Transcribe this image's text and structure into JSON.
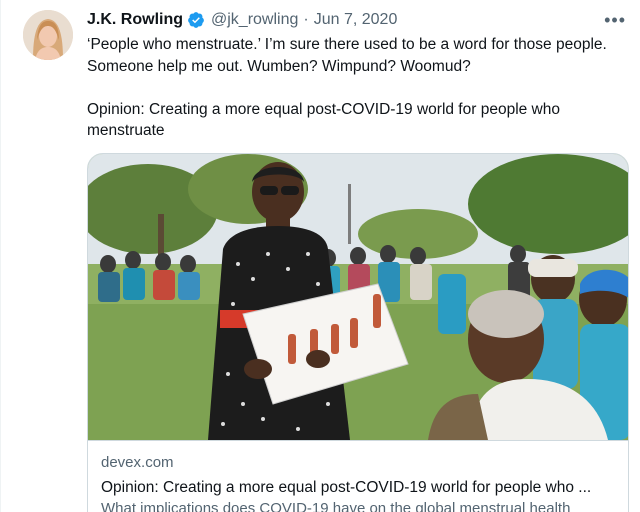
{
  "tweet": {
    "author": {
      "name": "J.K. Rowling",
      "handle": "@jk_rowling",
      "verified": true,
      "avatar_icon": "user-avatar"
    },
    "separator": "·",
    "date": "Jun 7, 2020",
    "more_icon": "more-horizontal-icon",
    "more_label": "•••",
    "text_line1": "‘People who menstruate.’ I’m sure there used to be a word for those people. Someone help me out. Wumben? Wimpund? Woomud?",
    "text_line2": "Opinion: Creating a more equal post-COVID-19 world for people who menstruate"
  },
  "card": {
    "domain": "devex.com",
    "title": "Opinion: Creating a more equal post-COVID-19 world for people who ...",
    "description": "What implications does COVID-19 have on the global menstrual health"
  },
  "colors": {
    "verified_blue": "#1d9bf0",
    "secondary_text": "#536471",
    "border": "#cfd9de"
  }
}
